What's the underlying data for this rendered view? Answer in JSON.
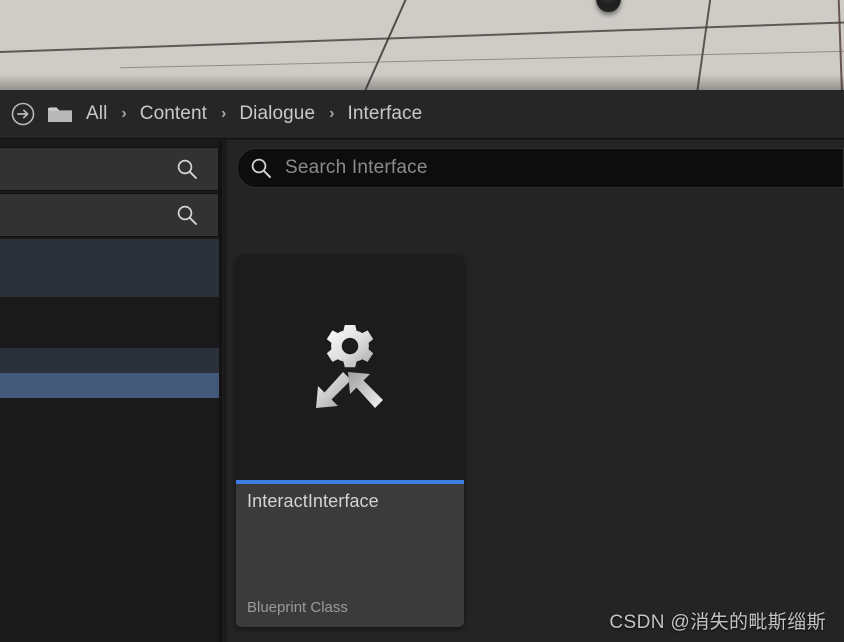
{
  "viewport": {
    "name": "level-viewport",
    "object_icon": "dark-sphere-object"
  },
  "breadcrumb": {
    "nav_icon": "arrow-right-circle-icon",
    "folder_icon": "folder-icon",
    "separator": "›",
    "items": [
      {
        "label": "All"
      },
      {
        "label": "Content"
      },
      {
        "label": "Dialogue"
      },
      {
        "label": "Interface"
      }
    ]
  },
  "left_panel": {
    "search_icon": "search-icon",
    "searches": [
      {
        "value": "",
        "placeholder": ""
      },
      {
        "value": "",
        "placeholder": ""
      }
    ],
    "rows": [
      {
        "state": "expanded-group"
      },
      {
        "state": "normal"
      },
      {
        "state": "hovered"
      },
      {
        "state": "selected"
      }
    ],
    "colors": {
      "selected": "#44597a",
      "highlight": "#2a313a",
      "background": "#1a1a1a"
    }
  },
  "content_browser": {
    "search": {
      "icon": "search-icon",
      "value": "",
      "placeholder": "Search Interface"
    },
    "assets": [
      {
        "name": "InteractInterface",
        "type": "Blueprint Class",
        "icon": "blueprint-interface-icon",
        "accent_color": "#3b7de0",
        "selected": true
      }
    ]
  },
  "watermark": {
    "text": "CSDN @消失的毗斯缁斯"
  }
}
